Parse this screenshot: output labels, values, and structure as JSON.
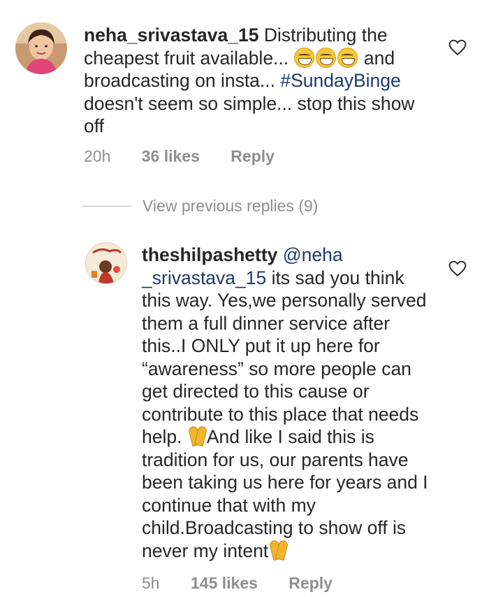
{
  "comment1": {
    "username": "neha_srivastava_15",
    "text_a": " Distributing the cheapest fruit available... ",
    "text_b": " and broadcasting on insta... ",
    "hashtag": "#SundayBinge",
    "text_c": " doesn't seem so simple... stop this show off",
    "time": "20h",
    "likes": "36 likes",
    "reply": "Reply",
    "avatar_icon": "profile-photo-woman",
    "emoji_icon": "grinning-squinting-face-emoji"
  },
  "view_previous": "View previous replies (9)",
  "comment2": {
    "username": "theshilpashetty",
    "mention": "@neha _srivastava_15",
    "text_a": " its sad you think this way. Yes,we personally served them  a full dinner service after this..I ONLY put it up here for “awareness” so more people can get directed to this cause or contribute to this place that needs help. ",
    "text_b": "And like I said this is tradition for us, our parents have been taking us here for years and I continue that with my child.Broadcasting to show off is never my intent",
    "time": "5h",
    "likes": "145 likes",
    "reply": "Reply",
    "avatar_icon": "profile-photo-book-cover",
    "emoji_icon": "folded-hands-emoji"
  },
  "colors": {
    "text": "#262626",
    "meta": "#8e8e8e",
    "link": "#1e3a6e"
  }
}
